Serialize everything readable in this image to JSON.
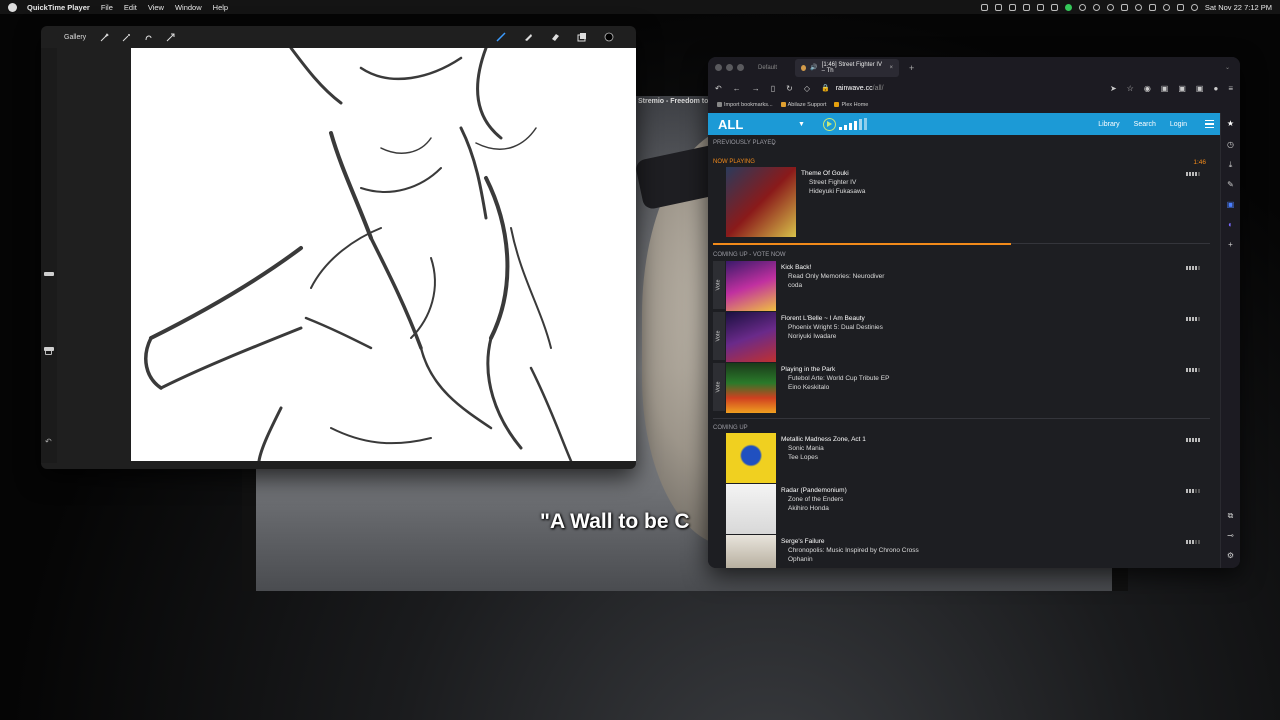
{
  "menubar": {
    "app_name": "QuickTime Player",
    "items": [
      "File",
      "Edit",
      "View",
      "Window",
      "Help"
    ],
    "datetime": "Sat Nov 22  7:12 PM"
  },
  "video": {
    "window_title": "Stremio - Freedom to",
    "subtitle": "\"A Wall to be C"
  },
  "procreate": {
    "gallery_label": "Gallery"
  },
  "browser": {
    "tab_default": "Default",
    "tab_active_title": "[1:46] Street Fighter IV – Th",
    "url_domain": "rainwave.cc",
    "url_path": "/all/",
    "bookmarks": [
      "Import bookmarks...",
      "Abilaze Support",
      "Plex Home"
    ]
  },
  "rainwave": {
    "station": "ALL",
    "nav": [
      "Library",
      "Search",
      "Login"
    ],
    "previously_played": "PREVIOUSLY PLAYED",
    "now_playing_label": "NOW PLAYING",
    "now_playing_time": "1:46",
    "now_playing": {
      "title": "Theme Of Gouki",
      "album": "Street Fighter IV",
      "artist": "Hideyuki Fukasawa",
      "rating": 4.0,
      "progress": 0.6
    },
    "coming_up_vote_label": "COMING UP - VOTE NOW",
    "vote_label": "Vote",
    "vote_songs": [
      {
        "title": "Kick Back!",
        "album": "Read Only Memories: Neurodiver",
        "artist": "coda",
        "rating": 4.0
      },
      {
        "title": "Florent L'Belle ~ I Am Beauty",
        "album": "Phoenix Wright 5: Dual Destinies",
        "artist": "Noriyuki Iwadare",
        "rating": 4.0
      },
      {
        "title": "Playing in the Park",
        "album": "Futebol Arte: World Cup Tribute EP",
        "artist": "Eino Keskitalo",
        "rating": 4.0
      }
    ],
    "coming_up_label": "COMING UP",
    "coming_songs": [
      {
        "title": "Metallic Madness Zone, Act 1",
        "album": "Sonic Mania",
        "artist": "Tee Lopes",
        "rating": 4.5
      },
      {
        "title": "Radar (Pandemonium)",
        "album": "Zone of the Enders",
        "artist": "Akihiro Honda",
        "rating": 3.5
      },
      {
        "title": "Serge's Failure",
        "album": "Chronopolis: Music Inspired by Chrono Cross",
        "artist": "Ophanin",
        "rating": 3.5
      }
    ]
  }
}
